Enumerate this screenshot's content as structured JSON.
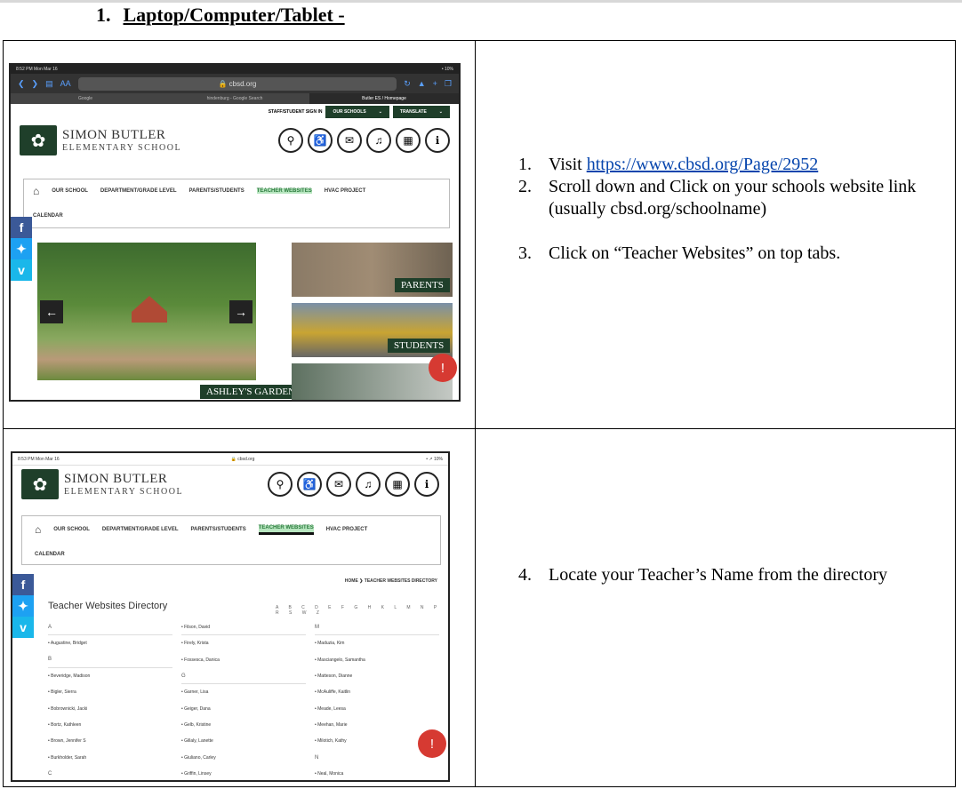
{
  "heading": {
    "number": "1.",
    "title": "Laptop/Computer/Tablet -"
  },
  "rows": [
    {
      "steps": [
        {
          "n": "1.",
          "text": "Visit ",
          "link": "https://www.cbsd.org/Page/2952"
        },
        {
          "n": "2.",
          "text": "Scroll down and Click on your schools website link (usually cbsd.org/schoolname)"
        },
        {
          "n": "3.",
          "text": "Click on “Teacher Websites” on top tabs."
        }
      ]
    },
    {
      "steps": [
        {
          "n": "4.",
          "text": "Locate your Teacher’s Name from the directory"
        }
      ]
    }
  ],
  "shot1": {
    "status_time": "8:52 PM   Mon Mar 16",
    "battery": "• 10%",
    "url": "🔒 cbsd.org",
    "text_size": "AA",
    "tabs": [
      "Google",
      "hindenburg - Google Search",
      "Butler ES / Homepage"
    ],
    "top_links": [
      "STAFF/STUDENT SIGN IN",
      "OUR SCHOOLS",
      "TRANSLATE"
    ],
    "school_name": "SIMON BUTLER",
    "school_sub": "ELEMENTARY SCHOOL",
    "menu": [
      "OUR SCHOOL",
      "DEPARTMENT/GRADE LEVEL",
      "PARENTS/STUDENTS",
      "TEACHER WEBSITES",
      "HVAC PROJECT",
      "CALENDAR"
    ],
    "tiles": [
      "PARENTS",
      "STUDENTS"
    ],
    "caption": "ASHLEY'S GARDEN"
  },
  "shot2": {
    "status_time": "8:53 PM   Mon Mar 16",
    "battery": "• ↗ 10%",
    "url": "🔒 cbsd.org",
    "school_name": "SIMON BUTLER",
    "school_sub": "ELEMENTARY SCHOOL",
    "menu": [
      "OUR SCHOOL",
      "DEPARTMENT/GRADE LEVEL",
      "PARENTS/STUDENTS",
      "TEACHER WEBSITES",
      "HVAC PROJECT",
      "CALENDAR"
    ],
    "breadcrumb": "HOME  ❯  TEACHER WEBSITES DIRECTORY",
    "dir_title": "Teacher Websites Directory",
    "alphabet": "A B C D E F G H K L M N P R S W Z",
    "col1": [
      "A",
      "•  Augustine, Bridget",
      "B",
      "•  Beveridge, Madison",
      "•  Bigler, Sierra",
      "•  Bobrownicki, Jacki",
      "•  Bortz, Kathleen",
      "•  Brown, Jennifer S",
      "•  Burkholder, Sarah",
      "C"
    ],
    "col2": [
      "•  Filson, David",
      "•  Firely, Krista",
      "•  Fossesca, Danica",
      "G",
      "•  Garner, Lisa",
      "•  Geiger, Dana",
      "•  Gelb, Kristine",
      "•  Gillaly, Lanette",
      "•  Giuliano, Carley",
      "•  Griffin, Linsey"
    ],
    "col3": [
      "M",
      "•  Maduzia, Kim",
      "•  Masciangelo, Samantha",
      "•  Matteson, Dianne",
      "•  McAuliffe, Kaitlin",
      "•  Meade, Leesa",
      "•  Meehan, Marie",
      "•  Milotich, Kathy",
      "N",
      "•  Neal, Monica"
    ]
  },
  "icons": {
    "alert": "!",
    "home": "⌂"
  }
}
